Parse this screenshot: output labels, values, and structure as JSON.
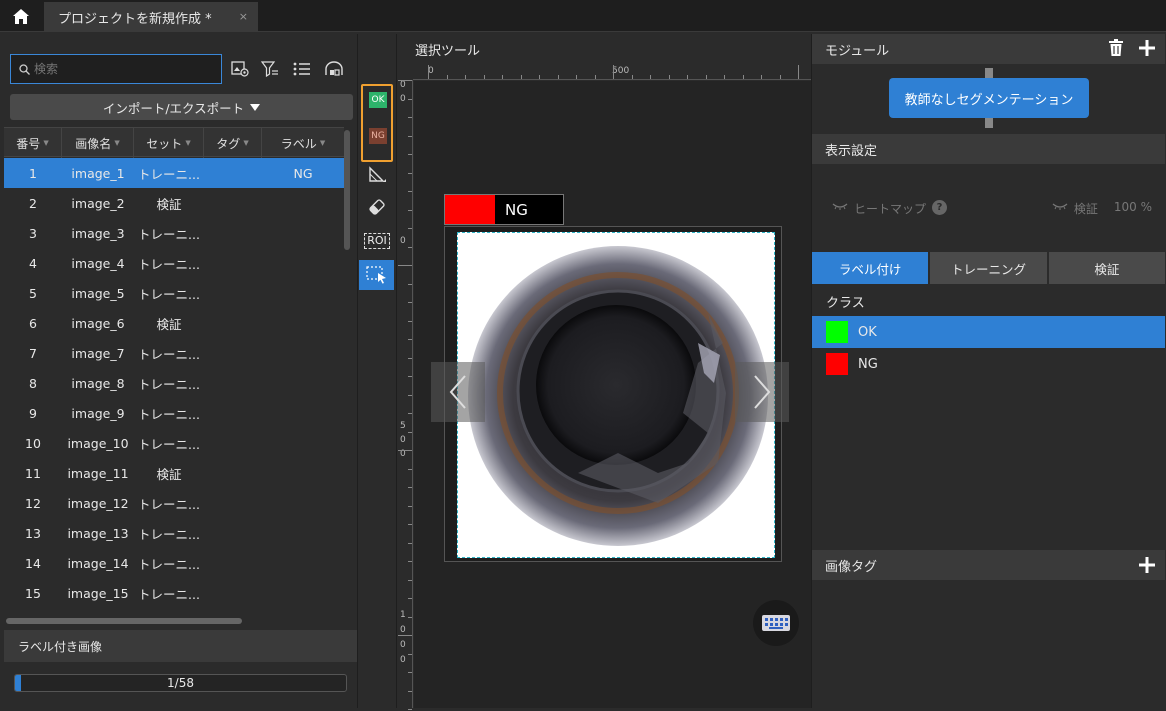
{
  "topbar": {
    "tab_title": "プロジェクトを新規作成 *",
    "close_glyph": "×"
  },
  "left": {
    "search_placeholder": "検索",
    "import_export_label": "インポート/エクスポート",
    "columns": [
      "番号",
      "画像名",
      "セット",
      "タグ",
      "ラベル"
    ],
    "rows": [
      {
        "no": "1",
        "name": "image_1",
        "set": "トレーニ...",
        "tag": "",
        "label": "NG"
      },
      {
        "no": "2",
        "name": "image_2",
        "set": "検証",
        "tag": "",
        "label": ""
      },
      {
        "no": "3",
        "name": "image_3",
        "set": "トレーニ...",
        "tag": "",
        "label": ""
      },
      {
        "no": "4",
        "name": "image_4",
        "set": "トレーニ...",
        "tag": "",
        "label": ""
      },
      {
        "no": "5",
        "name": "image_5",
        "set": "トレーニ...",
        "tag": "",
        "label": ""
      },
      {
        "no": "6",
        "name": "image_6",
        "set": "検証",
        "tag": "",
        "label": ""
      },
      {
        "no": "7",
        "name": "image_7",
        "set": "トレーニ...",
        "tag": "",
        "label": ""
      },
      {
        "no": "8",
        "name": "image_8",
        "set": "トレーニ...",
        "tag": "",
        "label": ""
      },
      {
        "no": "9",
        "name": "image_9",
        "set": "トレーニ...",
        "tag": "",
        "label": ""
      },
      {
        "no": "10",
        "name": "image_10",
        "set": "トレーニ...",
        "tag": "",
        "label": ""
      },
      {
        "no": "11",
        "name": "image_11",
        "set": "検証",
        "tag": "",
        "label": ""
      },
      {
        "no": "12",
        "name": "image_12",
        "set": "トレーニ...",
        "tag": "",
        "label": ""
      },
      {
        "no": "13",
        "name": "image_13",
        "set": "トレーニ...",
        "tag": "",
        "label": ""
      },
      {
        "no": "14",
        "name": "image_14",
        "set": "トレーニ...",
        "tag": "",
        "label": ""
      },
      {
        "no": "15",
        "name": "image_15",
        "set": "トレーニ...",
        "tag": "",
        "label": ""
      }
    ],
    "selected_row": 0,
    "labeled_images_title": "ラベル付き画像",
    "progress_text": "1/58",
    "progress_fraction": 0.017
  },
  "toolstrip": {
    "ok_tag": "OK",
    "ng_tag": "NG",
    "roi_label": "ROI"
  },
  "canvas": {
    "title": "選択ツール",
    "ruler_top": [
      "0",
      "500"
    ],
    "ruler_left": [
      "0",
      "0",
      "0",
      "5",
      "0",
      "0",
      "1",
      "0",
      "0",
      "0"
    ],
    "image_label": "NG",
    "image_label_color": "#ff0000"
  },
  "right": {
    "module_title": "モジュール",
    "module_button": "教師なしセグメンテーション",
    "display_title": "表示設定",
    "heatmap_label": "ヒートマップ",
    "verify_label": "検証",
    "verify_percent": "100 %",
    "tabs": [
      "ラベル付け",
      "トレーニング",
      "検証"
    ],
    "active_tab": 0,
    "class_title": "クラス",
    "classes": [
      {
        "name": "OK",
        "color": "#00ff00"
      },
      {
        "name": "NG",
        "color": "#ff0000"
      }
    ],
    "image_tag_title": "画像タグ"
  },
  "colors": {
    "accent": "#2f80d4",
    "highlight_border": "#f0a030"
  }
}
